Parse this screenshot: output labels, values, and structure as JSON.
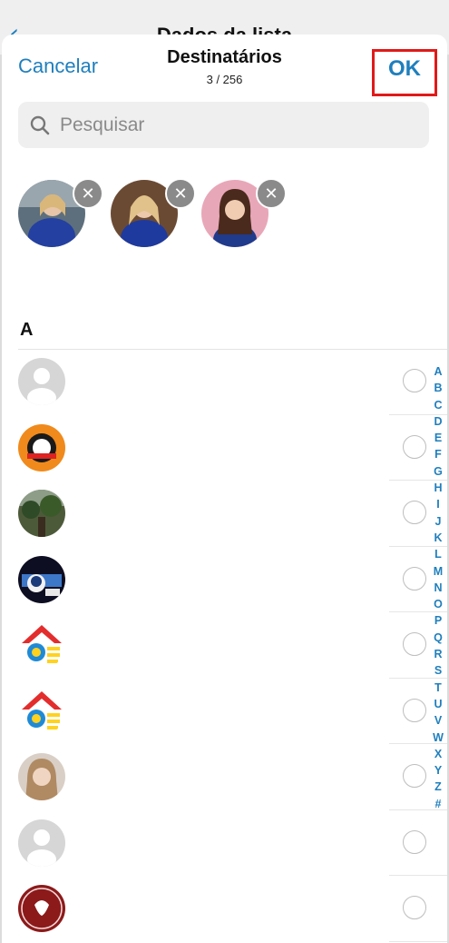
{
  "background": {
    "back_icon": "chevron-left-icon",
    "title": "Dados da lista"
  },
  "header": {
    "cancel_label": "Cancelar",
    "title": "Destinatários",
    "count": "3 / 256",
    "ok_label": "OK"
  },
  "search": {
    "placeholder": "Pesquisar",
    "icon": "search-icon"
  },
  "selected": [
    {
      "photo": "woman-blue-top-photo"
    },
    {
      "photo": "woman-blonde-photo"
    },
    {
      "photo": "woman-dark-hair-photo"
    }
  ],
  "section": {
    "letter": "A"
  },
  "contacts": [
    {
      "avatar": "default-avatar"
    },
    {
      "avatar": "orange-logo"
    },
    {
      "avatar": "forest-photo"
    },
    {
      "avatar": "cartoon-photo"
    },
    {
      "avatar": "house-logo"
    },
    {
      "avatar": "house-logo"
    },
    {
      "avatar": "woman-photo"
    },
    {
      "avatar": "default-avatar"
    },
    {
      "avatar": "red-logo"
    }
  ],
  "index_letters": [
    "A",
    "B",
    "C",
    "D",
    "E",
    "F",
    "G",
    "H",
    "I",
    "J",
    "K",
    "L",
    "M",
    "N",
    "O",
    "P",
    "Q",
    "R",
    "S",
    "T",
    "U",
    "V",
    "W",
    "X",
    "Y",
    "Z",
    "#"
  ],
  "colors": {
    "accent": "#1f7fbd",
    "highlight_box": "#e11919",
    "search_bg": "#efefef"
  }
}
